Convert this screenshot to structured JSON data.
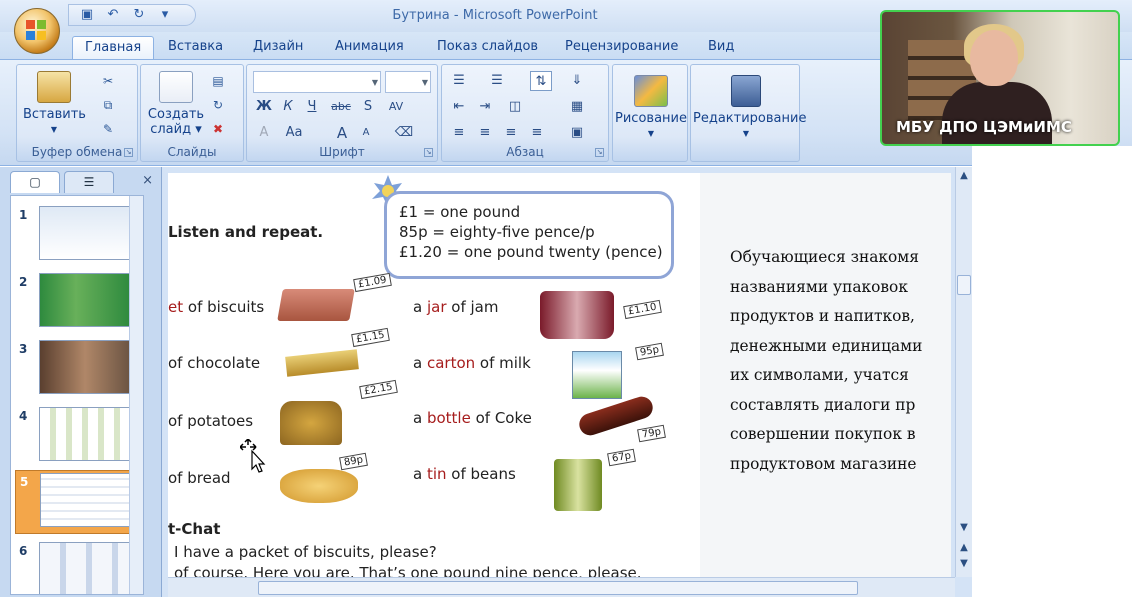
{
  "window": {
    "title": "Бутрина - Microsoft PowerPoint"
  },
  "qat": {
    "icons": [
      "save-icon",
      "undo-icon",
      "redo-icon",
      "customize-icon"
    ]
  },
  "tabs": [
    {
      "label": "Главная",
      "active": true
    },
    {
      "label": "Вставка"
    },
    {
      "label": "Дизайн"
    },
    {
      "label": "Анимация"
    },
    {
      "label": "Показ слайдов"
    },
    {
      "label": "Рецензирование"
    },
    {
      "label": "Вид"
    }
  ],
  "ribbon": {
    "clipboard": {
      "label": "Буфер обмена",
      "paste": "Вставить"
    },
    "slides": {
      "label": "Слайды",
      "new_slide_1": "Создать",
      "new_slide_2": "слайд"
    },
    "font": {
      "label": "Шрифт",
      "bold": "Ж",
      "italic": "К",
      "underline": "Ч",
      "strike": "abc",
      "shadow": "S",
      "spacing": "AV",
      "grow": "A",
      "shrink": "A",
      "case": "Aa"
    },
    "paragraph": {
      "label": "Абзац"
    },
    "drawing": {
      "label": "Рисование"
    },
    "editing": {
      "label": "Редактирование"
    }
  },
  "slides_panel": {
    "close": "×",
    "thumbnails": [
      {
        "num": "1"
      },
      {
        "num": "2"
      },
      {
        "num": "3"
      },
      {
        "num": "4"
      },
      {
        "num": "5",
        "selected": true
      },
      {
        "num": "6"
      }
    ]
  },
  "slide": {
    "listen": "Listen and repeat.",
    "price_box": [
      "£1 = one pound",
      "85p = eighty-five pence/p",
      "£1.20 = one pound twenty (pence)"
    ],
    "items_left": [
      {
        "pre": "",
        "kw": "et",
        "post": " of biscuits",
        "price": "£1.09"
      },
      {
        "pre": "of chocolate",
        "kw": "",
        "post": "",
        "price": "£1.15"
      },
      {
        "pre": "of potatoes",
        "kw": "",
        "post": "",
        "price": "£2.15"
      },
      {
        "pre": "of bread",
        "kw": "",
        "post": "",
        "price": "89p"
      }
    ],
    "items_right": [
      {
        "pre": "a ",
        "kw": "jar",
        "post": " of jam",
        "price": "£1.10"
      },
      {
        "pre": "a ",
        "kw": "carton",
        "post": " of milk",
        "price": "95p"
      },
      {
        "pre": "a ",
        "kw": "bottle",
        "post": " of Coke",
        "price": "79p"
      },
      {
        "pre": "a ",
        "kw": "tin",
        "post": " of beans",
        "price": "67p"
      }
    ],
    "chat_title": "t-Chat",
    "chat_lines": [
      "I have a packet of biscuits, please?",
      "of course. Here you are. That’s one pound nine pence, please."
    ],
    "description_lines": [
      "Обучающиеся знакомя",
      "названиями упаковок",
      "продуктов и напитков,",
      "денежными единицами",
      "их символами, учатся",
      "составлять диалоги пр",
      "совершении покупок в",
      "продуктовом магазине"
    ]
  },
  "video": {
    "label": "МБУ ДПО ЦЭМиИМС"
  }
}
